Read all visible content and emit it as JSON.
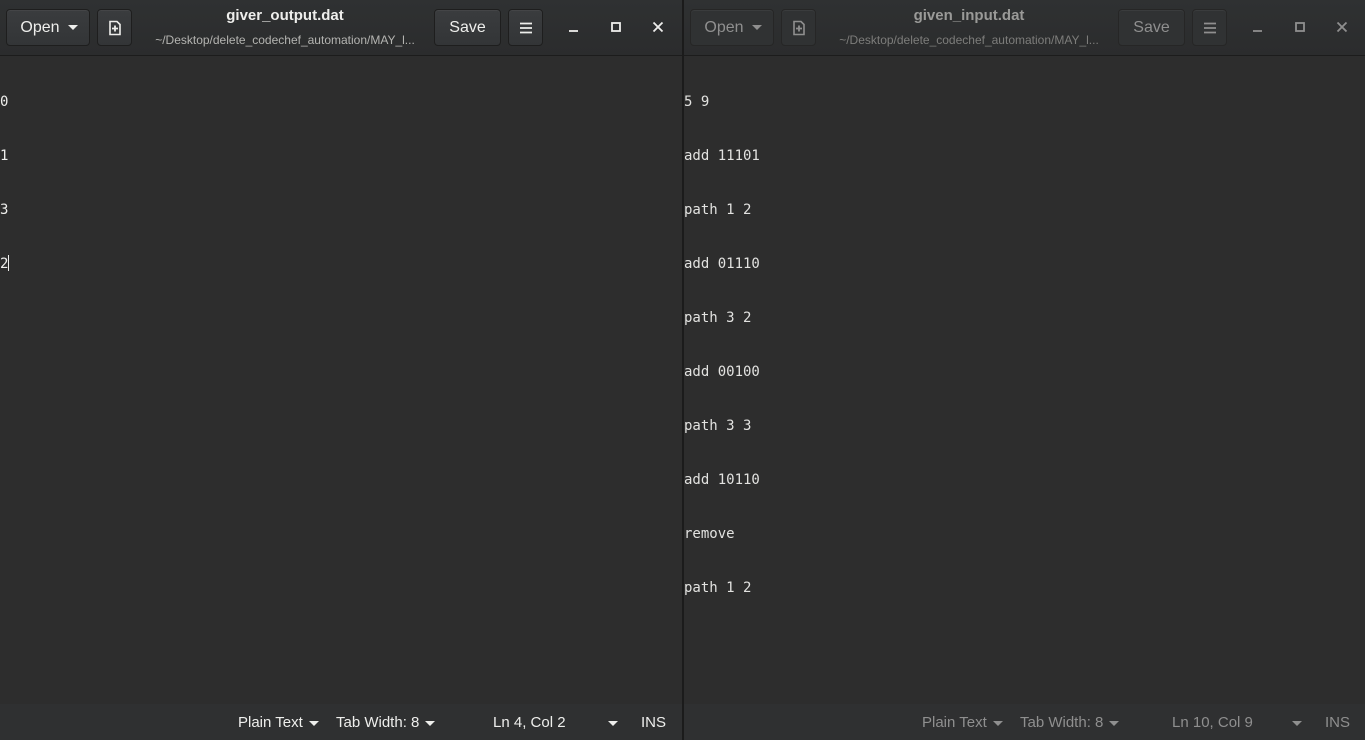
{
  "windows": [
    {
      "title": "giver_output.dat",
      "subtitle": "~/Desktop/delete_codechef_automation/MAY_l...",
      "open_label": "Open",
      "save_label": "Save",
      "lines": [
        "0",
        "1",
        "3",
        "2"
      ],
      "status": {
        "language": "Plain Text",
        "tab_width": "Tab Width: 8",
        "position": "Ln 4, Col 2",
        "mode": "INS"
      }
    },
    {
      "title": "given_input.dat",
      "subtitle": "~/Desktop/delete_codechef_automation/MAY_l...",
      "open_label": "Open",
      "save_label": "Save",
      "lines": [
        "5 9",
        "add 11101",
        "path 1 2",
        "add 01110",
        "path 3 2",
        "add 00100",
        "path 3 3",
        "add 10110",
        "remove",
        "path 1 2"
      ],
      "status": {
        "language": "Plain Text",
        "tab_width": "Tab Width: 8",
        "position": "Ln 10, Col 9",
        "mode": "INS"
      }
    }
  ],
  "icons": {
    "open_dropdown": "chevron-down-icon",
    "new_document": "new-document-icon",
    "menu": "hamburger-menu-icon",
    "minimize": "minimize-icon",
    "maximize": "maximize-icon",
    "close": "close-icon"
  },
  "colors": {
    "background": "#2d2d2d",
    "text": "#eeeeec",
    "inactive_text": "#8f8f8f"
  }
}
